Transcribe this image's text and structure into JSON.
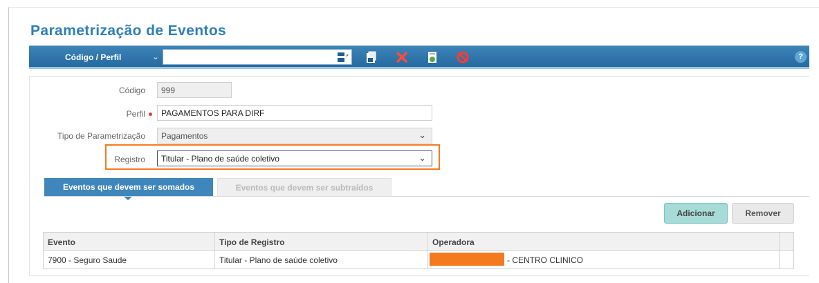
{
  "page": {
    "title": "Parametrização de Eventos"
  },
  "toolbar": {
    "label": "Código / Perfil",
    "select_value": "",
    "icons": [
      "save-icon",
      "save-as-icon",
      "delete-icon",
      "copy-icon",
      "cancel-icon"
    ],
    "help": "?"
  },
  "form": {
    "codigo": {
      "label": "Código",
      "value": "999"
    },
    "perfil": {
      "label": "Perfil",
      "value": "PAGAMENTOS PARA DIRF"
    },
    "tipo": {
      "label": "Tipo de Parametrização",
      "value": "Pagamentos"
    },
    "registro": {
      "label": "Registro",
      "value": "Titular - Plano de saúde coletivo"
    }
  },
  "tabs": [
    {
      "label": "Eventos que devem ser somados",
      "active": true
    },
    {
      "label": "Eventos que devem ser subtraídos",
      "active": false
    }
  ],
  "buttons": {
    "add": "Adicionar",
    "remove": "Remover"
  },
  "grid": {
    "headers": [
      "Evento",
      "Tipo de Registro",
      "Operadora"
    ],
    "rows": [
      {
        "evento": "7900 - Seguro Saude",
        "tipo": "Titular - Plano de saúde coletivo",
        "operadora": "- CENTRO CLINICO"
      }
    ]
  },
  "colors": {
    "accent": "#2f7fb5",
    "toolbar": "#266aa0",
    "highlight": "#f47a1f",
    "add_button": "#a7dbd7"
  }
}
